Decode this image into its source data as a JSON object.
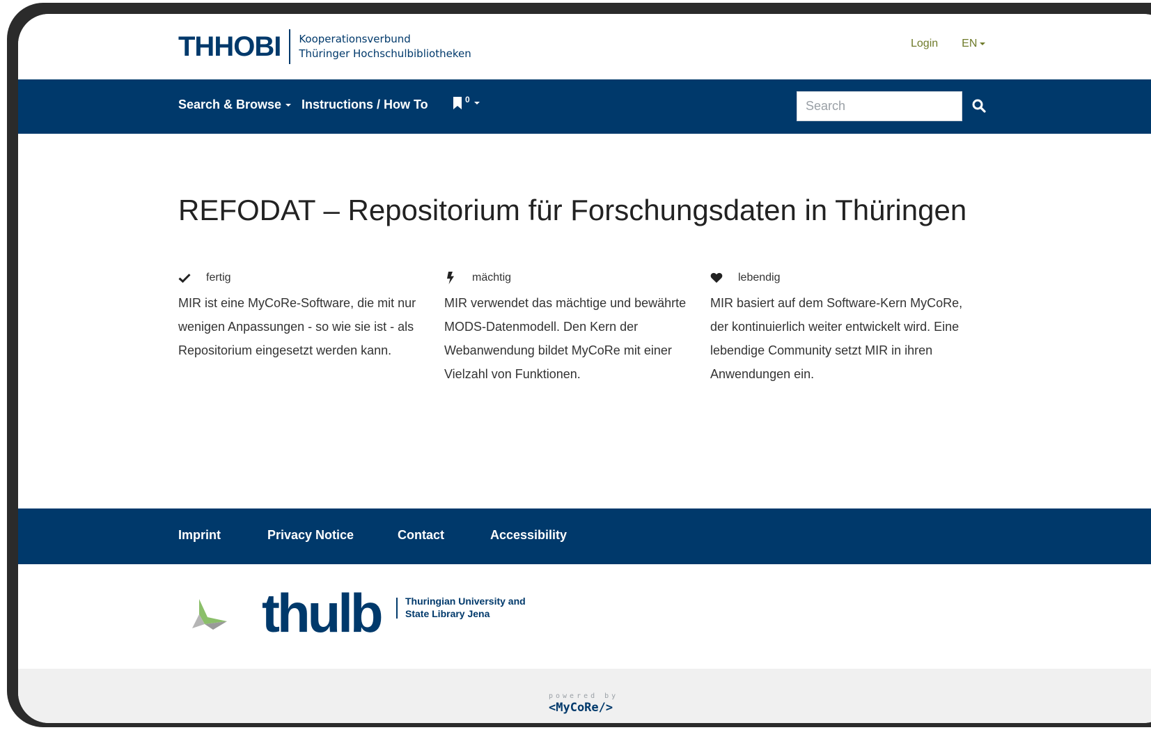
{
  "header": {
    "brand_mark": "THHOBI",
    "brand_line1": "Kooperationsverbund",
    "brand_line2": "Thüringer Hochschulbibliotheken",
    "login_label": "Login",
    "lang_label": "EN"
  },
  "navbar": {
    "search_browse": "Search & Browse",
    "instructions": "Instructions / How To",
    "bookmark_count": "0",
    "search_placeholder": "Search"
  },
  "main": {
    "title": "REFODAT – Repositorium für Forschungsdaten in Thüringen",
    "features": [
      {
        "icon": "check-icon",
        "label": "fertig",
        "text": "MIR ist eine MyCoRe-Software, die mit nur wenigen Anpassungen - so wie sie ist - als Repositorium eingesetzt werden kann."
      },
      {
        "icon": "bolt-icon",
        "label": "mächtig",
        "text": "MIR verwendet das mächtige und bewährte MODS-Datenmodell. Den Kern der Webanwendung bildet MyCoRe mit einer Vielzahl von Funktionen."
      },
      {
        "icon": "heart-icon",
        "label": "lebendig",
        "text": "MIR basiert auf dem Software-Kern MyCoRe, der kontinuierlich weiter entwickelt wird. Eine lebendige Community setzt MIR in ihren Anwendungen ein."
      }
    ]
  },
  "footer": {
    "links": [
      "Imprint",
      "Privacy Notice",
      "Contact",
      "Accessibility"
    ],
    "thulb_word": "thulb",
    "thulb_line1": "Thuringian University and",
    "thulb_line2": "State Library Jena",
    "powered_by": "powered by",
    "mycore": "<MyCoRe/>"
  },
  "colors": {
    "primary": "#00396b",
    "link_olive": "#6f7b2b",
    "text": "#333333"
  }
}
